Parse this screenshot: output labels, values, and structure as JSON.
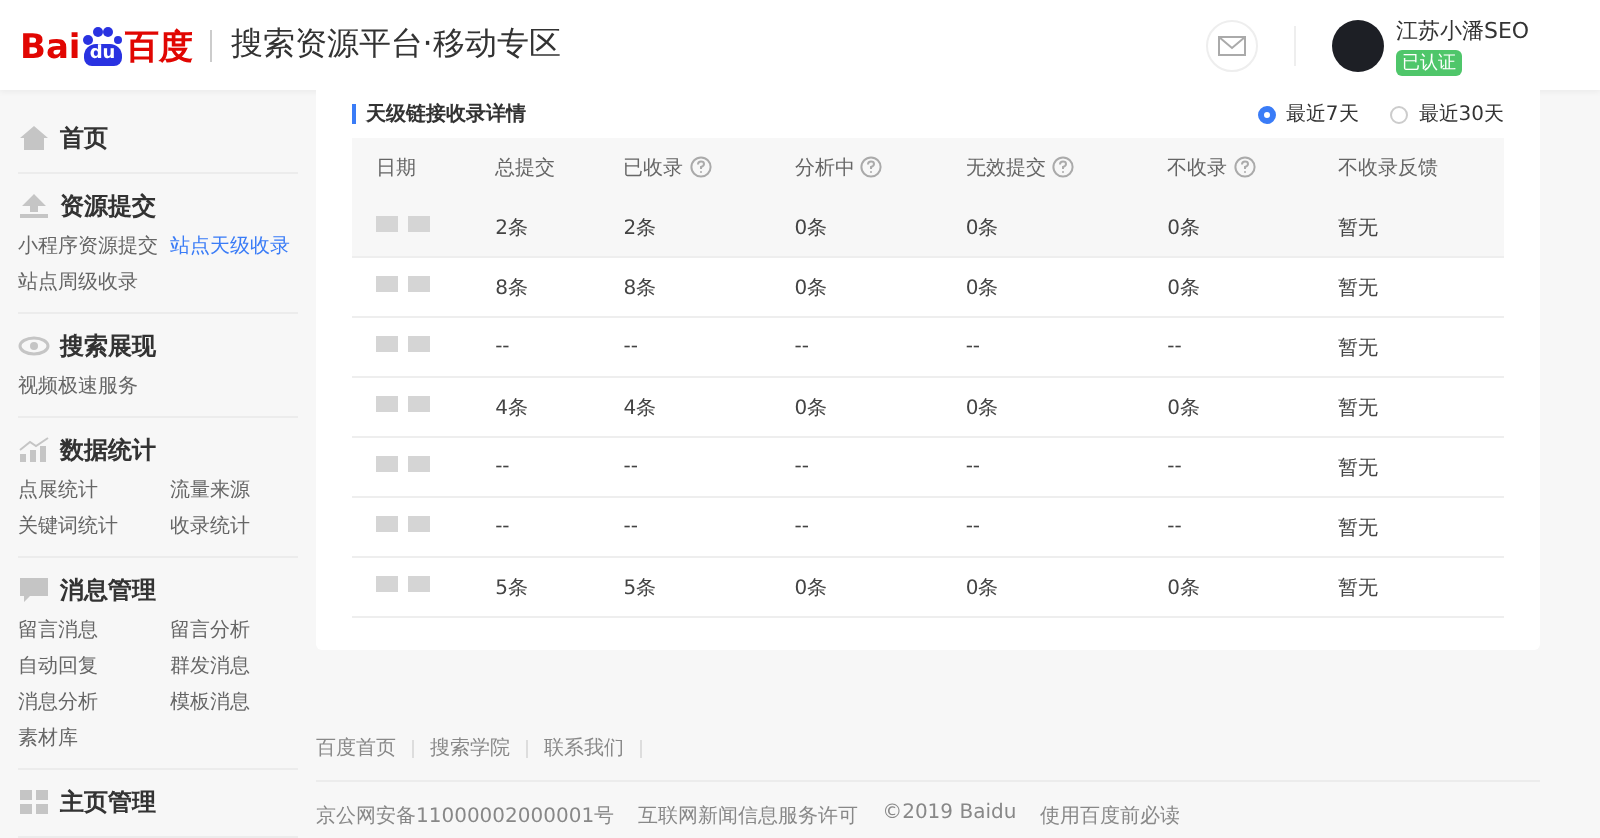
{
  "header": {
    "logo_text_latin": "Bai",
    "logo_text_paw": "du",
    "logo_text_cn": "百度",
    "title": "搜索资源平台·移动专区",
    "user": {
      "name": "江苏小潘SEO",
      "badge": "已认证"
    }
  },
  "sidebar": {
    "sections": [
      {
        "title": "首页"
      },
      {
        "title": "资源提交",
        "items": [
          {
            "label": "小程序资源提交",
            "selected": false
          },
          {
            "label": "站点天级收录",
            "selected": true
          },
          {
            "label": "站点周级收录",
            "selected": false
          }
        ]
      },
      {
        "title": "搜索展现",
        "items": [
          {
            "label": "视频极速服务",
            "selected": false
          }
        ]
      },
      {
        "title": "数据统计",
        "items": [
          {
            "label": "点展统计",
            "selected": false
          },
          {
            "label": "流量来源",
            "selected": false
          },
          {
            "label": "关键词统计",
            "selected": false
          },
          {
            "label": "收录统计",
            "selected": false
          }
        ]
      },
      {
        "title": "消息管理",
        "items": [
          {
            "label": "留言消息",
            "selected": false
          },
          {
            "label": "留言分析",
            "selected": false
          },
          {
            "label": "自动回复",
            "selected": false
          },
          {
            "label": "群发消息",
            "selected": false
          },
          {
            "label": "消息分析",
            "selected": false
          },
          {
            "label": "模板消息",
            "selected": false
          },
          {
            "label": "素材库",
            "selected": false
          }
        ]
      },
      {
        "title": "主页管理"
      }
    ]
  },
  "card": {
    "title": "天级链接收录详情",
    "ranges": [
      {
        "label": "最近7天",
        "selected": true
      },
      {
        "label": "最近30天",
        "selected": false
      }
    ],
    "table": {
      "columns": [
        {
          "label": "日期",
          "help": false
        },
        {
          "label": "总提交",
          "help": false
        },
        {
          "label": "已收录",
          "help": true
        },
        {
          "label": "分析中",
          "help": true
        },
        {
          "label": "无效提交",
          "help": true
        },
        {
          "label": "不收录",
          "help": true
        },
        {
          "label": "不收录反馈",
          "help": false
        }
      ],
      "rows": [
        {
          "highlighted": true,
          "cells": [
            "",
            "2条",
            "2条",
            "0条",
            "0条",
            "0条",
            "暂无"
          ]
        },
        {
          "highlighted": false,
          "cells": [
            "",
            "8条",
            "8条",
            "0条",
            "0条",
            "0条",
            "暂无"
          ]
        },
        {
          "highlighted": false,
          "cells": [
            "",
            "--",
            "--",
            "--",
            "--",
            "--",
            "暂无"
          ]
        },
        {
          "highlighted": false,
          "cells": [
            "",
            "4条",
            "4条",
            "0条",
            "0条",
            "0条",
            "暂无"
          ]
        },
        {
          "highlighted": false,
          "cells": [
            "",
            "--",
            "--",
            "--",
            "--",
            "--",
            "暂无"
          ]
        },
        {
          "highlighted": false,
          "cells": [
            "",
            "--",
            "--",
            "--",
            "--",
            "--",
            "暂无"
          ]
        },
        {
          "highlighted": false,
          "cells": [
            "",
            "5条",
            "5条",
            "0条",
            "0条",
            "0条",
            "暂无"
          ]
        }
      ]
    }
  },
  "footer": {
    "links": [
      "百度首页",
      "搜索学院",
      "联系我们"
    ],
    "legal": [
      "京公网安备11000002000001号",
      "互联网新闻信息服务许可",
      "©2019 Baidu",
      "使用百度前必读"
    ]
  }
}
